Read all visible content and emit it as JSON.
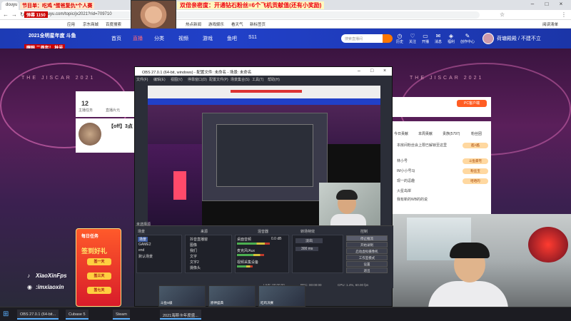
{
  "browser": {
    "tab_label": "douyu",
    "url": "douyu.com/topic/jx2021?rid=709710",
    "bookmarks": [
      "应用",
      "京东商城",
      "百度搜索",
      "热点新闻",
      "游戏娱乐",
      "看天气",
      "新标签页"
    ],
    "right_bookmark": "阅读清单"
  },
  "overlay": {
    "top_left_banner": "节目单：吃鸡 *蛋爸复仇*个人赛",
    "top_left_sub": "弹幕 1150",
    "top_center_banner": "双倍亲密度：开通钻石粉丝=6个飞机贡献值(还有小奖励)",
    "left_sub2": "瞎眼 二周年！ 秋号"
  },
  "douyu_header": {
    "logo": "2021全明星年度 斗鱼",
    "nav": [
      "首页",
      "直播",
      "分类",
      "视频",
      "游戏",
      "鱼吧",
      "S11"
    ],
    "active_nav": "直播",
    "search_placeholder": "搜索直播间",
    "icons": [
      {
        "icon": "history-icon",
        "label": "历史"
      },
      {
        "icon": "follow-icon",
        "label": "关注"
      },
      {
        "icon": "broadcast-icon",
        "label": "开播"
      },
      {
        "icon": "message-icon",
        "label": "消息"
      },
      {
        "icon": "task-icon",
        "label": "福利"
      },
      {
        "icon": "creator-icon",
        "label": "创作中心"
      }
    ],
    "username": "荷塘殿殿 / 不建不立"
  },
  "banner_text": "THE JISCAR 2021",
  "left_panel": {
    "number": "12",
    "sub_labels": [
      "主播任务",
      "直播片元"
    ],
    "room_title": "【off】3点"
  },
  "right_panel": {
    "pc_button": "PC客户端",
    "tabs": [
      "今日贡献",
      "本周贡献",
      "贵族(5797)",
      "粉丝团"
    ],
    "chat_lines": [
      "本房间粉丝会上限已解锁至这里",
      "林小号",
      "IM小小号马",
      "现一的逗趣",
      "火星岛岸",
      "我有新的WB的的说"
    ],
    "badges": [
      "超A酷",
      "斗鱼豪宅",
      "粉丝宝",
      "哈哈的"
    ]
  },
  "obs": {
    "title": "OBS 27.0.1 (64-bit, windows) - 配置文件: 未命名 - 场景: 未命名",
    "menu": [
      "文件(F)",
      "编辑(E)",
      "视图(V)",
      "停靠窗口(D)",
      "配置文件(P)",
      "场景集合(S)",
      "工具(T)",
      "帮助(H)"
    ],
    "no_source": "未选择源",
    "docks": {
      "scenes_title": "场景",
      "scenes": [
        "场景",
        "GAME2",
        "end",
        "默认场景"
      ],
      "selected_scene": "场景",
      "sources_title": "来源",
      "sources": [
        "抖音直播窗",
        "图像",
        "我们",
        "文字",
        "文字2",
        "摄像头"
      ],
      "mixer_title": "混音器",
      "mixer_items": [
        {
          "name": "桌面音频",
          "level": 0.62,
          "db": "0.0 dB"
        },
        {
          "name": "麦克风/Aux",
          "level": 0.48,
          "db": "0.0 dB"
        },
        {
          "name": "视频采集设备",
          "level": 0.3,
          "db": "0.0 dB"
        }
      ],
      "transition_title": "转场特效",
      "transition_type": "淡出",
      "transition_duration": "300 ms",
      "controls_title": "控制",
      "controls": [
        "停止推流",
        "开始录制",
        "启动虚拟摄像机",
        "工作室模式",
        "设置",
        "退出"
      ],
      "active_control": "停止推流"
    },
    "status": {
      "live": "LIVE: 00:00:00",
      "rec": "REC: 00:00:00",
      "cpu": "CPU: 1.4%, 60.00 fps"
    }
  },
  "thumbs": [
    "斗鱼S级",
    "原神盛典",
    "吃鸡决赛"
  ],
  "promo": {
    "tag": "每日任务",
    "title": "签到好礼",
    "items": [
      "签一天",
      "签三天",
      "签七天"
    ]
  },
  "social": {
    "tiktok": "XiaoXinFps",
    "weibo": ":imxiaoxin"
  },
  "taskbar": {
    "items": [
      "OBS 27.0.1 (64-bit...",
      "Cubase 5",
      "Steam",
      "2021海斯卡年度盛..."
    ]
  },
  "colors": {
    "douyu_blue": "#2140c8",
    "douyu_orange": "#ff5d23",
    "live_red": "#ff4a6a"
  }
}
